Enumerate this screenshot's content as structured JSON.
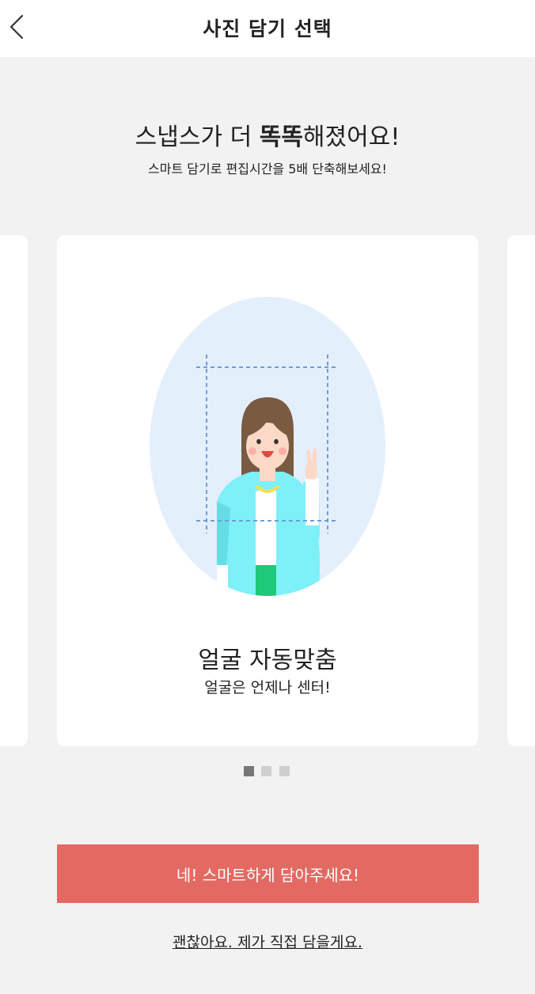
{
  "header": {
    "title": "사진 담기 선택"
  },
  "intro": {
    "headline_pre": "스냅스가 더 ",
    "headline_bold": "똑똑",
    "headline_post": "해졌어요!",
    "subline": "스마트 담기로 편집시간을 5배 단축해보세요!"
  },
  "carousel": {
    "current_slide": {
      "title": "얼굴 자동맞춤",
      "description": "얼굴은 언제나 센터!",
      "illustration": "face-centering-illustration"
    },
    "total_slides": 3,
    "active_index": 0
  },
  "actions": {
    "primary_label": "네! 스마트하게 담아주세요!",
    "secondary_label": "괜찮아요. 제가 직접 담을게요."
  },
  "colors": {
    "primary_button": "#e26a63",
    "background": "#f2f2f2",
    "oval": "#e4effc",
    "jacket": "#7ef0f7",
    "pants": "#1fc97a"
  }
}
